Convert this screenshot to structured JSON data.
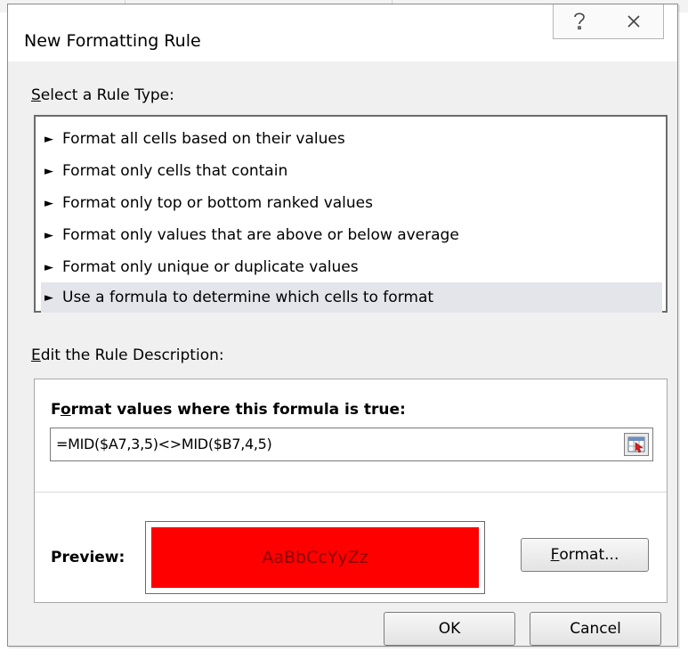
{
  "dialog": {
    "title": "New Formatting Rule",
    "help_icon": "question-mark-icon",
    "close_icon": "close-x-icon"
  },
  "rule_type": {
    "label_prefix": "",
    "label_underlined": "S",
    "label_rest": "elect a Rule Type:",
    "items": [
      {
        "label": "Format all cells based on their values",
        "selected": false
      },
      {
        "label": "Format only cells that contain",
        "selected": false
      },
      {
        "label": "Format only top or bottom ranked values",
        "selected": false
      },
      {
        "label": "Format only values that are above or below average",
        "selected": false
      },
      {
        "label": "Format only unique or duplicate values",
        "selected": false
      },
      {
        "label": "Use a formula to determine which cells to format",
        "selected": true
      }
    ],
    "item_icon": "arrow-right-icon"
  },
  "rule_description": {
    "label_underlined": "E",
    "label_rest": "dit the Rule Description:",
    "formula_heading_pre": "F",
    "formula_heading_underlined": "o",
    "formula_heading_rest": "rmat values where this formula is true:",
    "formula_value": "=MID($A7,3,5)<>MID($B7,4,5)",
    "ref_button_icon": "range-select-icon",
    "preview_label": "Preview:",
    "preview_text": "AaBbCcYyZz",
    "preview_fill": "#ff0000",
    "preview_text_color": "#8b0000",
    "format_button_underlined": "F",
    "format_button_rest": "ormat..."
  },
  "footer": {
    "ok_label": "OK",
    "cancel_label": "Cancel"
  }
}
